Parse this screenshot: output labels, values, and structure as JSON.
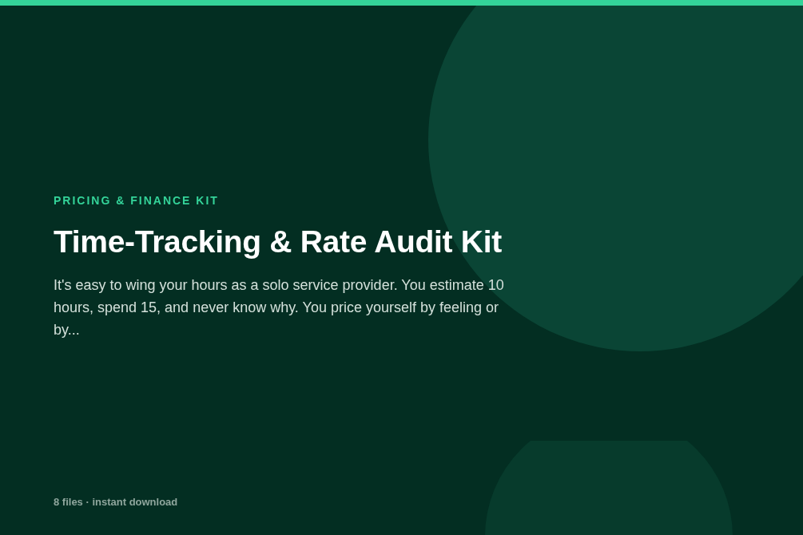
{
  "eyebrow": "PRICING & FINANCE KIT",
  "title": "Time-Tracking & Rate Audit Kit",
  "description": "It's easy to wing your hours as a solo service provider. You estimate 10 hours, spend 15, and never know why. You price yourself by feeling or by...",
  "footer": "8 files · instant download"
}
